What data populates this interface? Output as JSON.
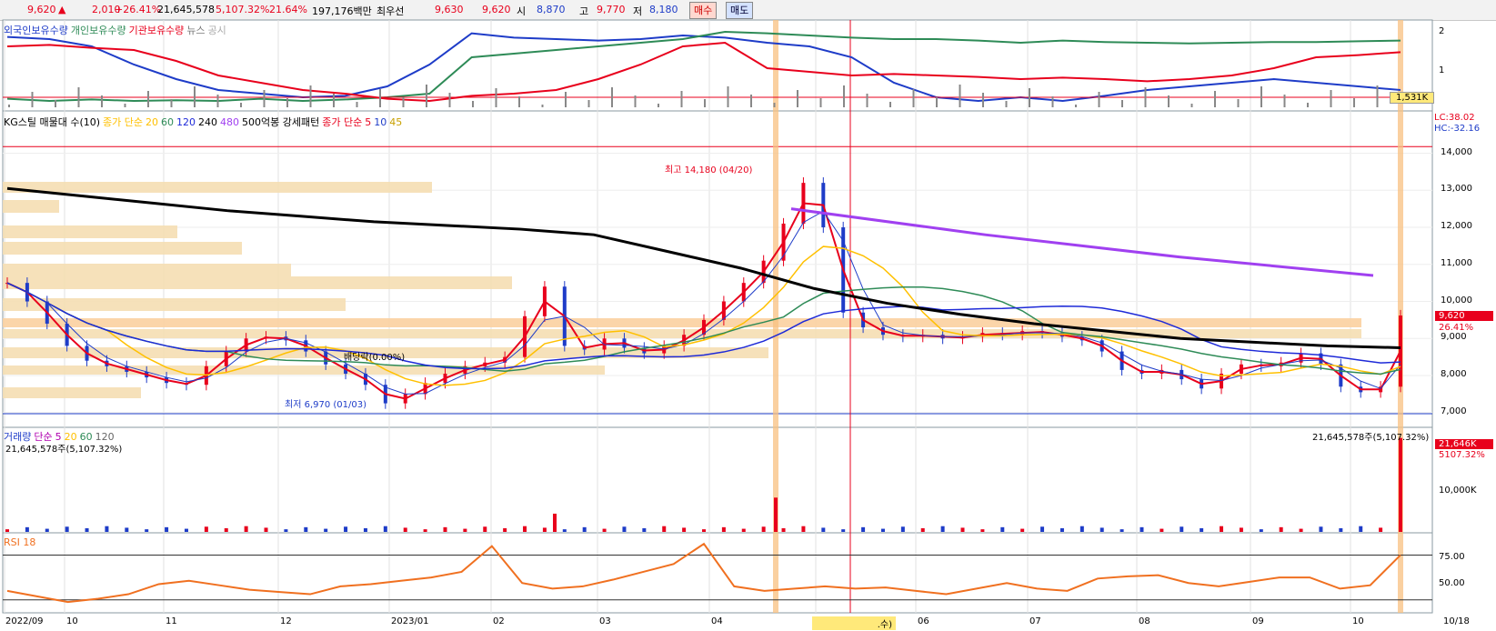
{
  "header": {
    "price": "9,620",
    "change_icon": "up-triangle-icon",
    "change": "2,010",
    "change_pct": "+26.41%",
    "volume": "21,645,578",
    "volume_pct": "5,107.32%",
    "turnover": "21.64%",
    "amount": "197,176백만",
    "name": "최우선",
    "ask": "9,630",
    "bid": "9,620",
    "open_label": "시",
    "open": "8,870",
    "high_label": "고",
    "high": "9,770",
    "low_label": "저",
    "low": "8,180",
    "buy_label": "매수",
    "sell_label": "매도"
  },
  "pane1": {
    "legend": [
      "외국인보유수량",
      "개인보유수량",
      "기관보유수량",
      "뉴스",
      "공시"
    ],
    "ticks": [
      "2",
      "1"
    ],
    "badge": "1,531K"
  },
  "pane2": {
    "legend_title": "KG스틸 매물대 수(10)",
    "legend_ma": "종가 단순",
    "ma_long": [
      "20",
      "60",
      "120",
      "240",
      "480"
    ],
    "legend_extra": "500억봉 강세패턴",
    "legend_ma2": "종가 단순",
    "ma_short": [
      "5",
      "10",
      "45"
    ],
    "lc": "LC:38.02",
    "hc": "HC:-32.16",
    "high_note": "최고 14,180 (04/20)",
    "low_note": "최저 6,970 (01/03)",
    "dividend_note": "배당락(0.00%)",
    "price_badge": "9,620",
    "pct_badge": "26.41%",
    "ticks": [
      "14,000",
      "13,000",
      "12,000",
      "11,000",
      "10,000",
      "9,000",
      "8,000",
      "7,000"
    ]
  },
  "pane3": {
    "legend_title": "거래량",
    "legend_ma": "단순",
    "ma": [
      "5",
      "20",
      "60",
      "120"
    ],
    "stat_left": "21,645,578주(5,107.32%)",
    "stat_right": "21,645,578주(5,107.32%)",
    "badge": "21,646K",
    "badge2": "5107.32%",
    "ticks": [
      "10,000K"
    ]
  },
  "pane4": {
    "legend": "RSI 18",
    "ticks": [
      "75.00",
      "50.00"
    ]
  },
  "xaxis": {
    "labels": [
      "2022/09",
      "10",
      "11",
      "12",
      "2023/01",
      "02",
      "03",
      "04",
      "05",
      "06",
      "07",
      "08",
      "09",
      "10",
      "10/18"
    ],
    "cursor_label": ".수)"
  },
  "colors": {
    "up": "#e8001c",
    "down": "#1e3cc8",
    "ma5": "#e8001c",
    "ma10": "#1e3cc8",
    "ma20": "#ffc000",
    "ma60": "#2e8b57",
    "ma120": "#1e2ad8",
    "ma240": "#000000",
    "ma480": "#a040f0",
    "rsi": "#f07020",
    "band": "#f5deb3"
  },
  "chart_data": {
    "type": "line",
    "title": "KG스틸",
    "price_range": [
      6700,
      14700
    ],
    "months": [
      "2022/09",
      "10",
      "11",
      "12",
      "2023/01",
      "02",
      "03",
      "04",
      "05",
      "06",
      "07",
      "08",
      "09",
      "10"
    ],
    "close": [
      10500,
      10000,
      9400,
      8800,
      8400,
      8250,
      8100,
      7950,
      7800,
      7750,
      8250,
      8650,
      9000,
      9050,
      8950,
      8650,
      8300,
      8050,
      7750,
      7250,
      7500,
      7800,
      8050,
      8250,
      8350,
      8500,
      9600,
      10400,
      8800,
      8700,
      9000,
      8750,
      8600,
      8800,
      9100,
      9500,
      10000,
      10500,
      11100,
      12100,
      13200,
      12000,
      9700,
      9300,
      9100,
      9050,
      9100,
      9000,
      9050,
      9150,
      9100,
      9200,
      9150,
      9050,
      8950,
      8650,
      8150,
      8050,
      8150,
      7900,
      7650,
      8050,
      8300,
      8250,
      8350,
      8600,
      8300,
      7700,
      7550,
      7700,
      9620
    ],
    "high_point": {
      "date": "04/20",
      "value": 14180
    },
    "low_point": {
      "date": "01/03",
      "value": 6970
    },
    "ma240": [
      13050,
      12850,
      12650,
      12450,
      12300,
      12150,
      12050,
      11950,
      11800,
      11350,
      10900,
      10350,
      9950,
      9650,
      9400,
      9200,
      9000,
      8900,
      8800,
      8750
    ],
    "ma480": [
      12500,
      11800,
      11200,
      10700
    ],
    "volume_spikes_k": [
      {
        "date": "02",
        "value": 4200
      },
      {
        "date": "04/20",
        "value": 7900
      },
      {
        "date": "10/18",
        "value": 21646
      }
    ],
    "rsi": [
      38,
      33,
      28,
      31,
      35,
      44,
      47,
      43,
      39,
      37,
      35,
      42,
      44,
      47,
      50,
      55,
      78,
      45,
      40,
      42,
      48,
      55,
      62,
      80,
      42,
      38,
      40,
      42,
      40,
      41,
      38,
      35,
      40,
      45,
      40,
      38,
      49,
      51,
      52,
      45,
      42,
      46,
      50,
      50,
      40,
      43,
      70
    ]
  }
}
